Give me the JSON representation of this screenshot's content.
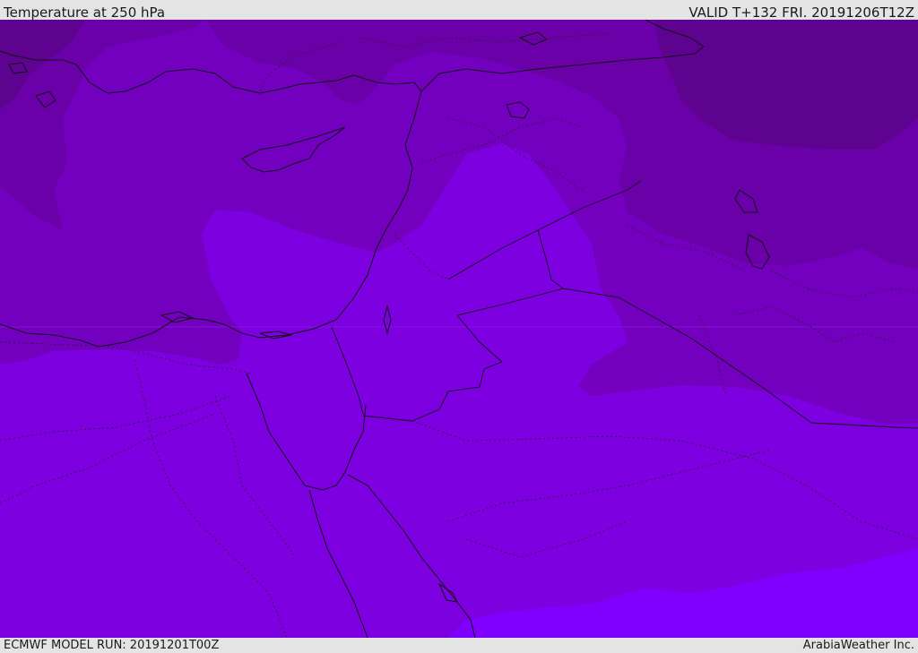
{
  "header": {
    "title": "Temperature at 250 hPa",
    "valid": "VALID T+132 FRI. 20191206T12Z"
  },
  "footer": {
    "model_run": "ECMWF MODEL RUN: 20191201T00Z",
    "credit": "ArabiaWeather Inc."
  },
  "map": {
    "colors": {
      "coldest": "#5d0390",
      "colder": "#6a00a8",
      "cold": "#7400bf",
      "base": "#7d00e0",
      "warm": "#7f00ff"
    }
  }
}
